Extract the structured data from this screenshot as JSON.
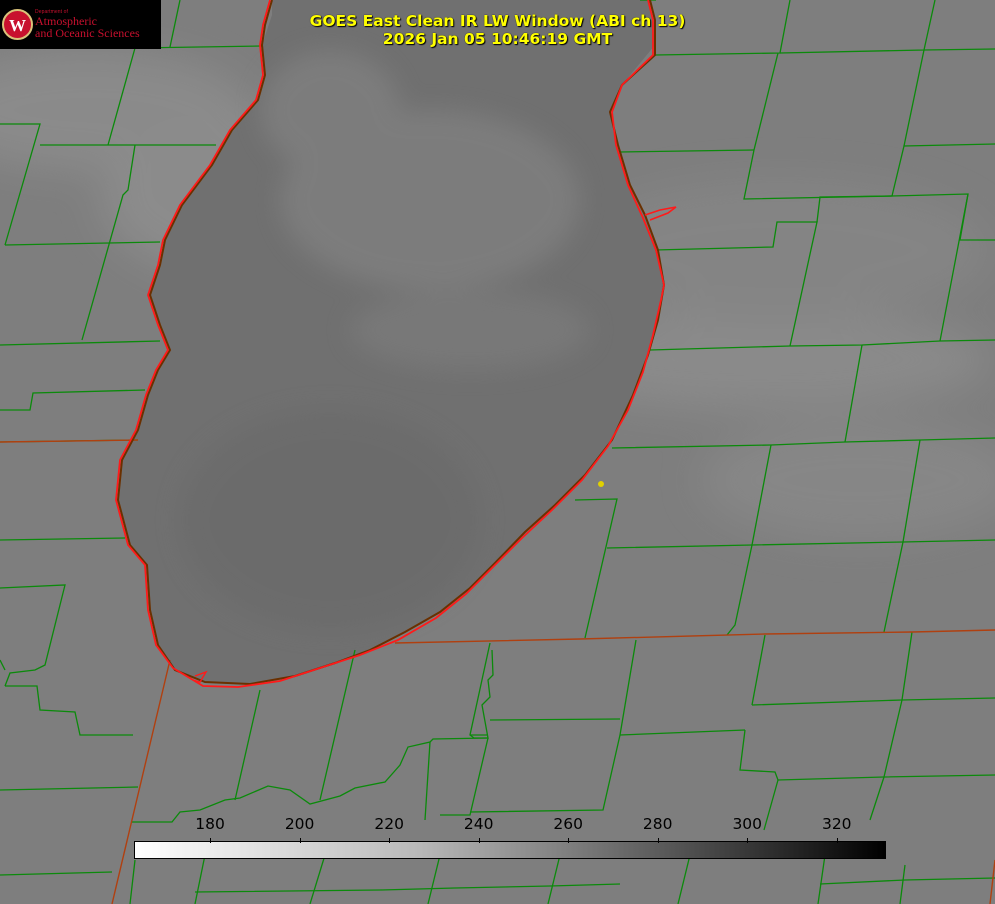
{
  "header": {
    "title_line1": "GOES East Clean IR LW Window (ABI ch 13)",
    "title_line2": "2026 Jan 05 10:46:19 GMT"
  },
  "logo": {
    "department": "Department of",
    "line1": "Atmospheric",
    "line2": "and Oceanic Sciences",
    "emblem_icon": "uw-crest-icon",
    "brand_color": "#c8102e"
  },
  "colorbar": {
    "tick_values": [
      180,
      200,
      220,
      240,
      260,
      280,
      300,
      320
    ],
    "range": [
      163,
      331
    ],
    "scale_low_color": "#ffffff",
    "scale_high_color": "#000000"
  },
  "colors": {
    "background_gray": "#7e7e7e",
    "county_lines": "#0b8a0b",
    "state_lines": "#b04010",
    "lake_shoreline": "#ff1a1a",
    "title_text": "#ffff00",
    "marker": "#e0d000"
  }
}
